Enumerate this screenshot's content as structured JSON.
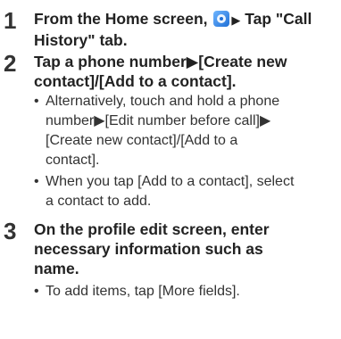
{
  "steps": [
    {
      "number": "1",
      "title_part1": "From the Home screen,",
      "title_arrow": "▶",
      "title_part2": "Tap \"Call History\" tab.",
      "icon": "phone-app-icon"
    },
    {
      "number": "2",
      "title_line1": "Tap a phone number▶[Create new",
      "title_line2": "contact]/[Add to a contact].",
      "bullets": [
        {
          "marker": "•",
          "lines": [
            "Alternatively, touch and hold a phone",
            "number▶[Edit number before call]▶",
            "[Create new contact]/[Add to a",
            "contact]."
          ]
        },
        {
          "marker": "•",
          "lines": [
            "When you tap [Add to a contact], select",
            "a contact to add."
          ]
        }
      ]
    },
    {
      "number": "3",
      "title_line1": "On the profile edit screen, enter",
      "title_line2": "necessary information such as",
      "title_line3": "name.",
      "bullets": [
        {
          "marker": "•",
          "lines": [
            "To add items, tap [More fields]."
          ]
        }
      ]
    }
  ]
}
